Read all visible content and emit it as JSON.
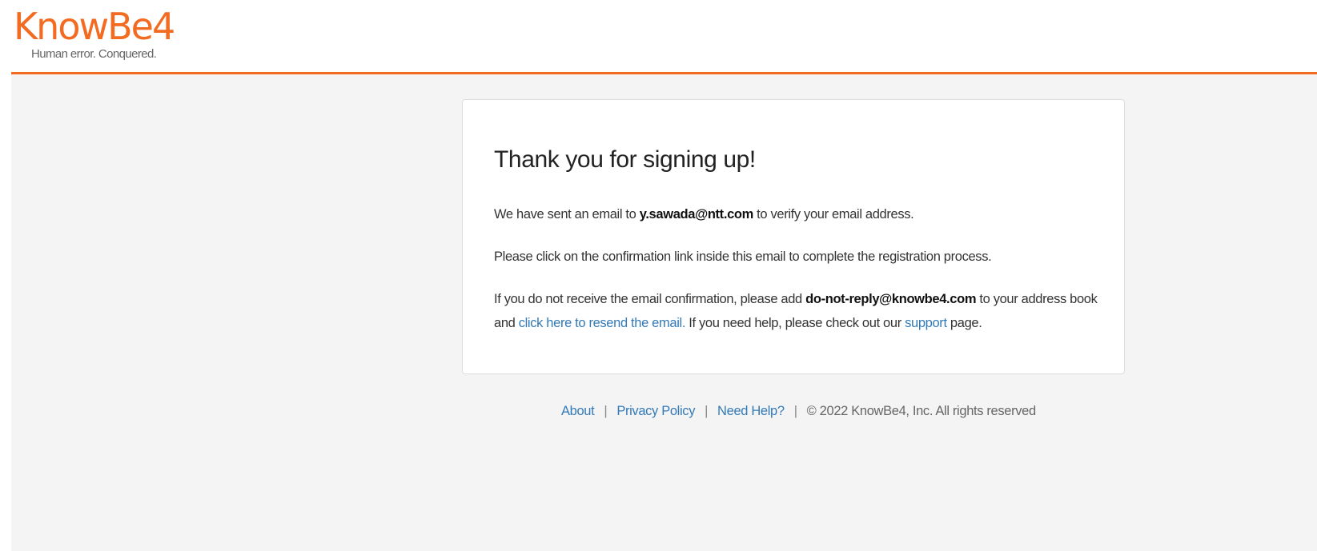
{
  "brand": {
    "name_part1": "Kn",
    "name_o": "o",
    "name_part2": "wBe4",
    "tagline": "Human error. Conquered.",
    "accent_color": "#f26b21"
  },
  "card": {
    "title": "Thank you for signing up!",
    "p1_before": "We have sent an email to ",
    "p1_email": "y.sawada@ntt.com",
    "p1_after": " to verify your email address.",
    "p2": "Please click on the confirmation link inside this email to complete the registration process.",
    "p3_before": "If you do not receive the email confirmation, please add ",
    "p3_email": "do-not-reply@knowbe4.com",
    "p3_after": " to your address book",
    "p3_line2_before": "and ",
    "resend_link": "click here to resend the email.",
    "p3_line2_middle": " If you need help, please check out our ",
    "support_link": "support",
    "p3_line2_after": " page."
  },
  "footer": {
    "about": "About",
    "privacy": "Privacy Policy",
    "help": "Need Help?",
    "separator": "|",
    "copyright": "© 2022 KnowBe4, Inc. All rights reserved"
  }
}
